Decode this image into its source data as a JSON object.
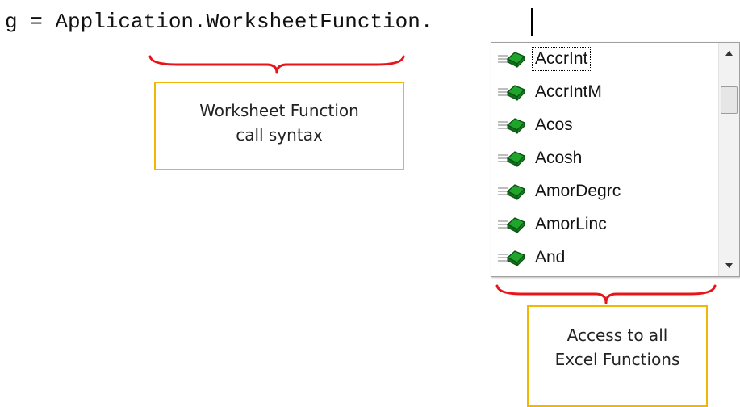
{
  "editor": {
    "code_line": "g = Application.WorksheetFunction."
  },
  "autocomplete": {
    "icon": "method-icon",
    "selected_index": 0,
    "items": [
      "AccrInt",
      "AccrIntM",
      "Acos",
      "Acosh",
      "AmorDegrc",
      "AmorLinc",
      "And"
    ]
  },
  "annotations": {
    "syntax": {
      "line1": "Worksheet Function",
      "line2": "call syntax"
    },
    "functions": {
      "line1": "Access to all",
      "line2": "Excel Functions"
    }
  },
  "colors": {
    "brace": "#e8141a",
    "callout_border": "#f2b705",
    "icon_green": "#1fa52b"
  }
}
